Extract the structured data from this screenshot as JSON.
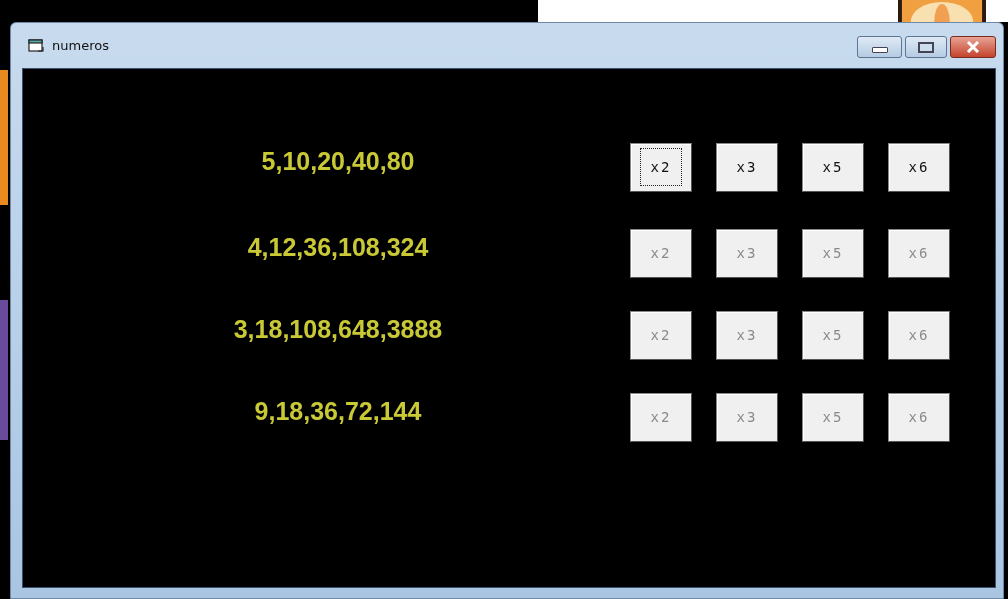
{
  "window": {
    "title": "numeros"
  },
  "rows": [
    {
      "sequence": "5,10,20,40,80",
      "buttons": [
        {
          "label": "x2",
          "disabled": false,
          "focused": true
        },
        {
          "label": "x3",
          "disabled": false,
          "focused": false
        },
        {
          "label": "x5",
          "disabled": false,
          "focused": false
        },
        {
          "label": "x6",
          "disabled": false,
          "focused": false
        }
      ]
    },
    {
      "sequence": "4,12,36,108,324",
      "buttons": [
        {
          "label": "x2",
          "disabled": true,
          "focused": false
        },
        {
          "label": "x3",
          "disabled": true,
          "focused": false
        },
        {
          "label": "x5",
          "disabled": true,
          "focused": false
        },
        {
          "label": "x6",
          "disabled": true,
          "focused": false
        }
      ]
    },
    {
      "sequence": "3,18,108,648,3888",
      "buttons": [
        {
          "label": "x2",
          "disabled": true,
          "focused": false
        },
        {
          "label": "x3",
          "disabled": true,
          "focused": false
        },
        {
          "label": "x5",
          "disabled": true,
          "focused": false
        },
        {
          "label": "x6",
          "disabled": true,
          "focused": false
        }
      ]
    },
    {
      "sequence": "9,18,36,72,144",
      "buttons": [
        {
          "label": "x2",
          "disabled": true,
          "focused": false
        },
        {
          "label": "x3",
          "disabled": true,
          "focused": false
        },
        {
          "label": "x5",
          "disabled": true,
          "focused": false
        },
        {
          "label": "x6",
          "disabled": true,
          "focused": false
        }
      ]
    }
  ]
}
